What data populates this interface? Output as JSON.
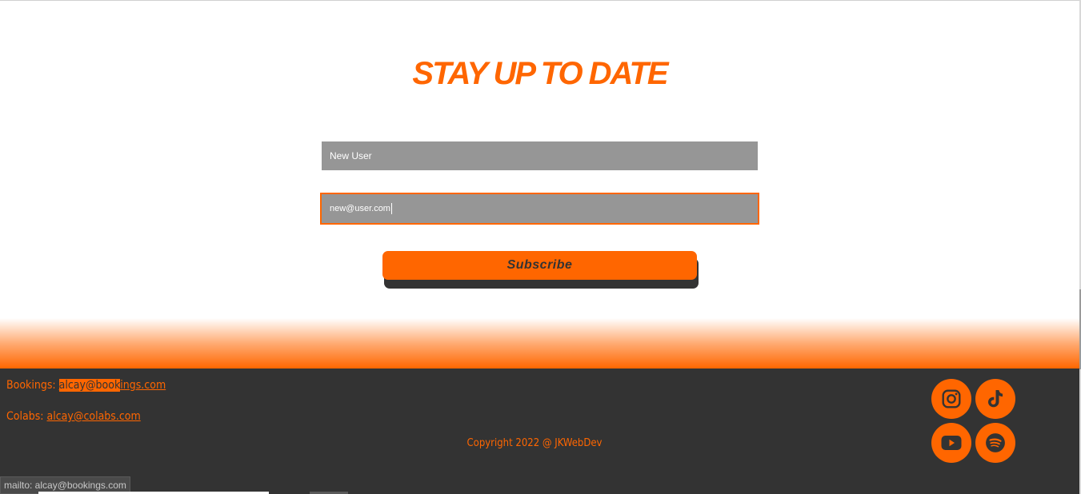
{
  "signup": {
    "title": "Stay up to date",
    "name_value": "New User",
    "email_value": "new@user.com",
    "subscribe_label": "Subscribe"
  },
  "footer": {
    "bookings_label": "Bookings:",
    "bookings_email_highlight": "alcay@book",
    "bookings_email_rest": "ings.com",
    "colabs_label": "Colabs:",
    "colabs_email": "alcay@colabs.com",
    "copyright": "Copyright 2022 @ JKWebDev",
    "social": [
      "instagram-icon",
      "tiktok-icon",
      "youtube-icon",
      "spotify-icon"
    ]
  },
  "status_bar": {
    "text": "mailto: alcay@bookings.com"
  },
  "colors": {
    "accent": "#ff6600",
    "dark": "#333333",
    "field": "#969696"
  }
}
